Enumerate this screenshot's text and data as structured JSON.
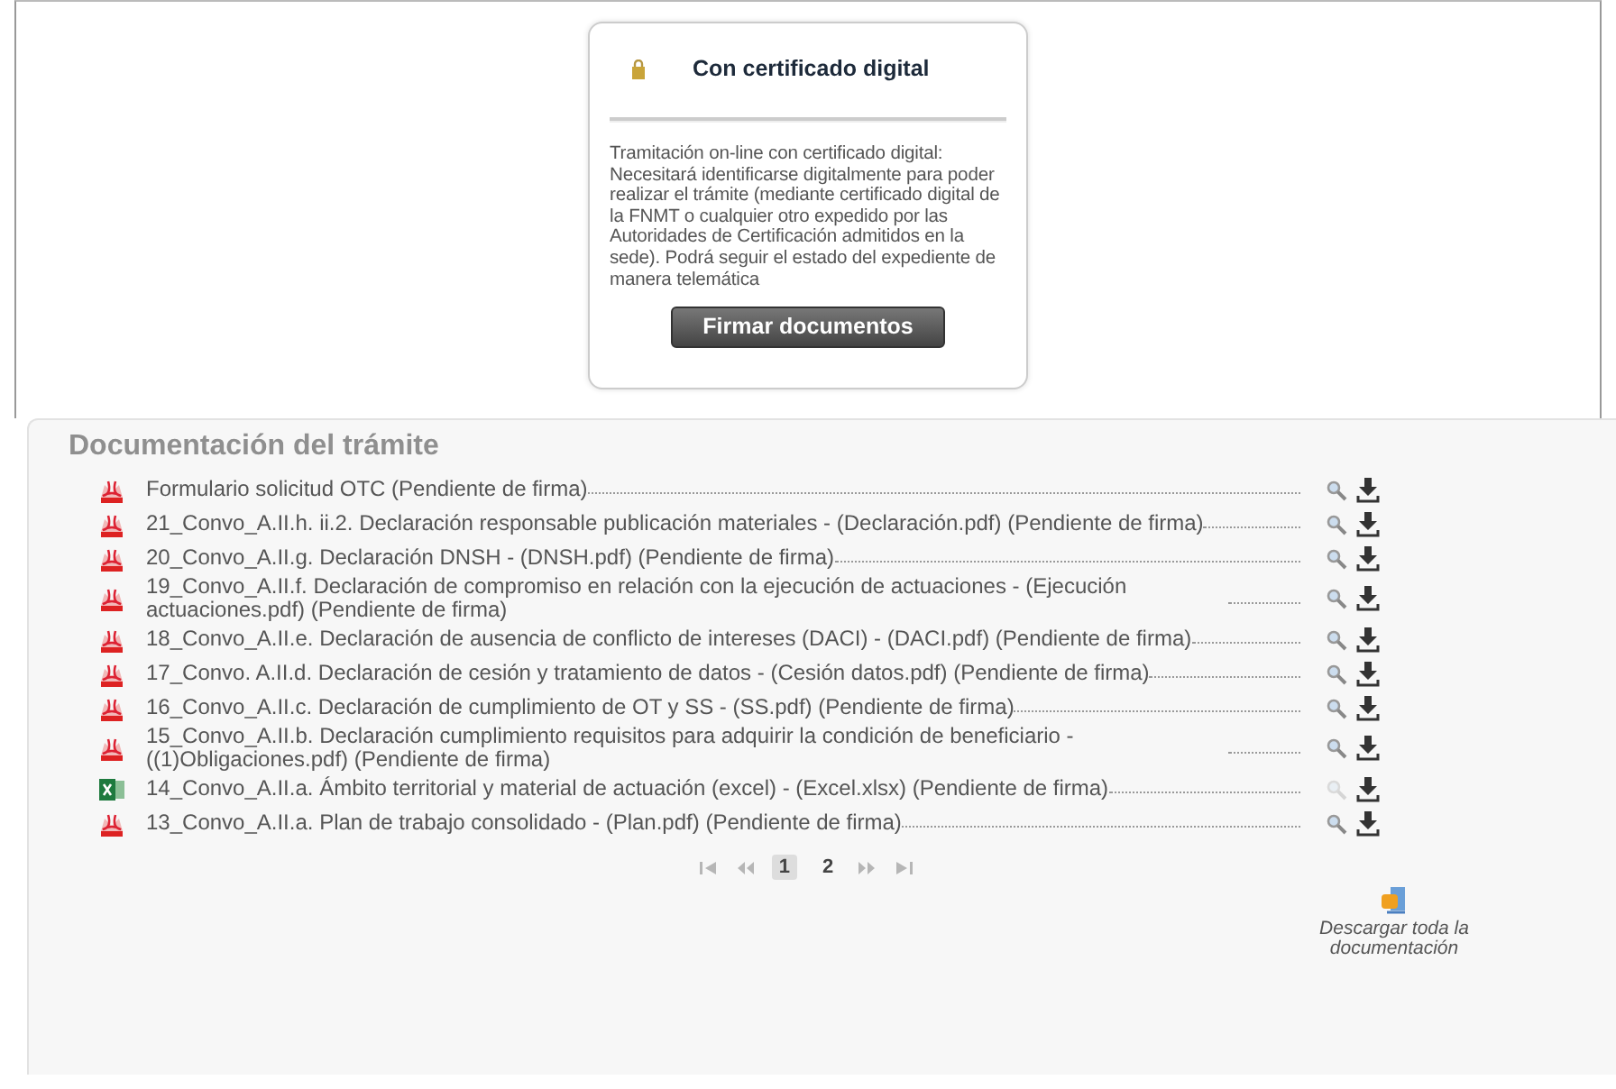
{
  "certificate_card": {
    "title": "Con certificado digital",
    "description": "Tramitación on-line con certificado digital: Necesitará identificarse digitalmente para poder realizar el trámite (mediante certificado digital de la FNMT o cualquier otro expedido por las Autoridades de Certificación admitidos en la sede). Podrá seguir el estado del expediente de manera telemática",
    "button": "Firmar documentos"
  },
  "documents": {
    "title": "Documentación del trámite",
    "items": [
      {
        "kind": "pdf",
        "label": "Formulario solicitud OTC (Pendiente de firma)",
        "preview_enabled": true
      },
      {
        "kind": "pdf",
        "label": "21_Convo_A.II.h. ii.2. Declaración responsable publicación materiales - (Declaración.pdf) (Pendiente de firma)",
        "preview_enabled": true
      },
      {
        "kind": "pdf",
        "label": "20_Convo_A.II.g. Declaración DNSH - (DNSH.pdf) (Pendiente de firma)",
        "preview_enabled": true
      },
      {
        "kind": "pdf",
        "label": "19_Convo_A.II.f. Declaración de compromiso en relación con la ejecución de actuaciones - (Ejecución actuaciones.pdf) (Pendiente de firma)",
        "preview_enabled": true
      },
      {
        "kind": "pdf",
        "label": "18_Convo_A.II.e. Declaración de ausencia de conflicto de intereses (DACI) - (DACI.pdf) (Pendiente de firma)",
        "preview_enabled": true
      },
      {
        "kind": "pdf",
        "label": "17_Convo. A.II.d. Declaración de cesión y tratamiento de datos - (Cesión datos.pdf) (Pendiente de firma)",
        "preview_enabled": true
      },
      {
        "kind": "pdf",
        "label": "16_Convo_A.II.c. Declaración de cumplimiento de OT y SS - (SS.pdf) (Pendiente de firma)",
        "preview_enabled": true
      },
      {
        "kind": "pdf",
        "label": "15_Convo_A.II.b. Declaración cumplimiento requisitos para adquirir la condición de beneficiario - ((1)Obligaciones.pdf) (Pendiente de firma)",
        "preview_enabled": true
      },
      {
        "kind": "excel",
        "label": "14_Convo_A.II.a. Ámbito territorial y material de actuación (excel) - (Excel.xlsx) (Pendiente de firma)",
        "preview_enabled": false
      },
      {
        "kind": "pdf",
        "label": "13_Convo_A.II.a. Plan de trabajo consolidado - (Plan.pdf) (Pendiente de firma)",
        "preview_enabled": true
      }
    ],
    "pages": [
      {
        "label": "1",
        "selected": true
      },
      {
        "label": "2",
        "selected": false
      }
    ],
    "download_all": "Descargar toda la documentación"
  }
}
